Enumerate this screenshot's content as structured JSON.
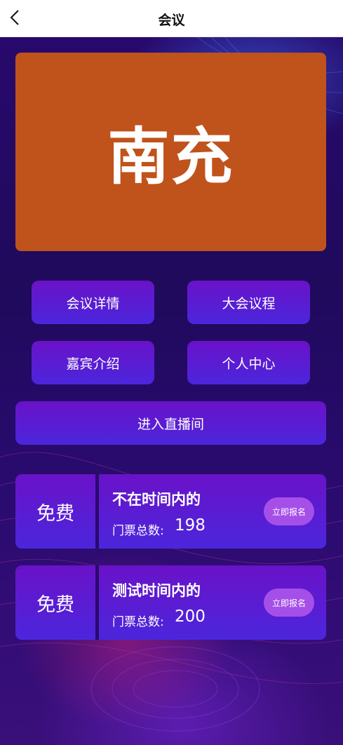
{
  "nav": {
    "title": "会议",
    "back_icon": "chevron-left-icon"
  },
  "banner": {
    "text": "南充",
    "background": "#c0521b"
  },
  "menu": {
    "details": "会议详情",
    "agenda": "大会议程",
    "guests": "嘉宾介绍",
    "personal": "个人中心",
    "live": "进入直播间"
  },
  "tickets": [
    {
      "price": "免费",
      "name": "不在时间内的",
      "count_label": "门票总数:",
      "count": "198",
      "signup": "立即报名"
    },
    {
      "price": "免费",
      "name": "测试时间内的",
      "count_label": "门票总数:",
      "count": "200",
      "signup": "立即报名"
    }
  ],
  "colors": {
    "accent_start": "#6a12c8",
    "accent_end": "#4b26dc",
    "signup_button": "#a64fe8"
  }
}
